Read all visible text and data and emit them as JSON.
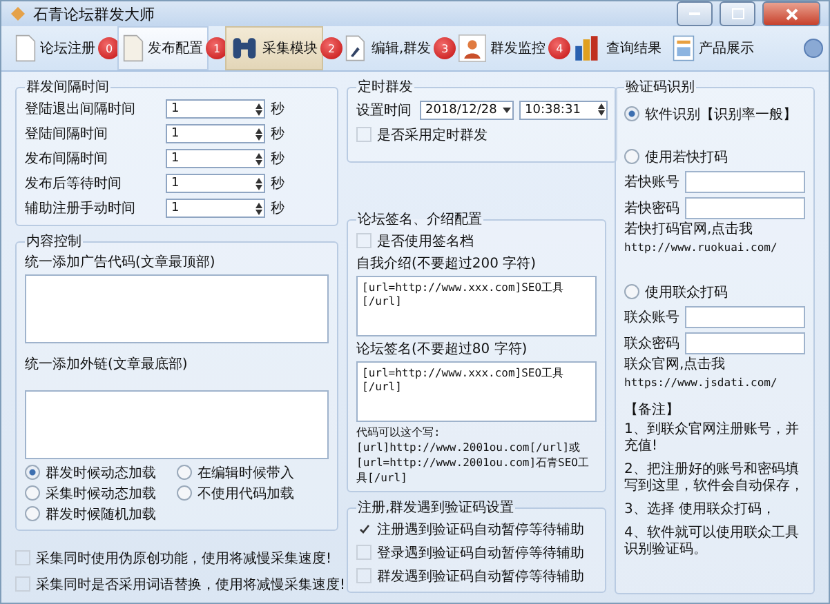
{
  "window": {
    "title": "石青论坛群发大师"
  },
  "toolbar": {
    "tabs": [
      {
        "label": "论坛注册",
        "selected": false,
        "highlighted": false,
        "badge": "0"
      },
      {
        "label": "发布配置",
        "selected": true,
        "highlighted": false,
        "badge": "1"
      },
      {
        "label": "采集模块",
        "selected": false,
        "highlighted": true,
        "badge": "2"
      },
      {
        "label": "编辑,群发",
        "selected": false,
        "highlighted": false,
        "badge": "3"
      },
      {
        "label": "群发监控",
        "selected": false,
        "highlighted": false,
        "badge": "4"
      },
      {
        "label": "查询结果",
        "selected": false,
        "highlighted": false
      },
      {
        "label": "产品展示",
        "selected": false,
        "highlighted": false
      }
    ]
  },
  "intervals": {
    "title": "群发间隔时间",
    "rows": [
      {
        "label": "登陆退出间隔时间",
        "value": "1",
        "unit": "秒"
      },
      {
        "label": "登陆间隔时间",
        "value": "1",
        "unit": "秒"
      },
      {
        "label": "发布间隔时间",
        "value": "1",
        "unit": "秒"
      },
      {
        "label": "发布后等待时间",
        "value": "1",
        "unit": "秒"
      },
      {
        "label": "辅助注册手动时间",
        "value": "1",
        "unit": "秒"
      }
    ]
  },
  "content_control": {
    "title": "内容控制",
    "ad_label": "统一添加广告代码(文章最顶部)",
    "link_label": "统一添加外链(文章最底部)",
    "options": [
      {
        "label": "群发时候动态加载",
        "selected": true
      },
      {
        "label": "在编辑时候带入",
        "selected": false
      },
      {
        "label": "采集时候动态加载",
        "selected": false
      },
      {
        "label": "不使用代码加载",
        "selected": false
      },
      {
        "label": "群发时候随机加载",
        "selected": false
      }
    ]
  },
  "collect_options": [
    {
      "label": "采集同时使用伪原创功能，使用将减慢采集速度!",
      "checked": false
    },
    {
      "label": "采集同时是否采用词语替换，使用将减慢采集速度!",
      "checked": false
    }
  ],
  "schedule": {
    "title": "定时群发",
    "time_label": "设置时间",
    "date": "2018/12/28",
    "time": "10:38:31",
    "enable": {
      "label": "是否采用定时群发",
      "checked": false
    }
  },
  "signature": {
    "title": "论坛签名、介绍配置",
    "use": {
      "label": "是否使用签名档",
      "checked": false
    },
    "intro_label": "自我介绍(不要超过200 字符)",
    "intro": "[url=http://www.xxx.com]SEO工具[/url]",
    "sig_label": "论坛签名(不要超过80 字符)",
    "sig": "[url=http://www.xxx.com]SEO工具[/url]",
    "hint": "代码可以这个写:\n[url]http://www.2001ou.com[/url]或\n[url=http://www.2001ou.com]石青SEO工具[/url]"
  },
  "captcha_settings": {
    "title": "注册,群发遇到验证码设置",
    "options": [
      {
        "label": "注册遇到验证码自动暂停等待辅助",
        "checked": true
      },
      {
        "label": "登录遇到验证码自动暂停等待辅助",
        "checked": false
      },
      {
        "label": "群发遇到验证码自动暂停等待辅助",
        "checked": false
      }
    ]
  },
  "recognition": {
    "title": "验证码识别",
    "software": {
      "label": "软件识别【识别率一般】",
      "selected": true
    },
    "ruokuai": {
      "label": "使用若快打码",
      "selected": false,
      "account_label": "若快账号",
      "password_label": "若快密码",
      "site_text": "若快打码官网,点击我",
      "site_url": "http://www.ruokuai.com/"
    },
    "lianzhong": {
      "label": "使用联众打码",
      "selected": false,
      "account_label": "联众账号",
      "password_label": "联众密码",
      "site_text": "联众官网,点击我",
      "site_url": "https://www.jsdati.com/"
    },
    "notes_title": "【备注】",
    "notes": [
      "1、到联众官网注册账号，并充值!",
      "2、把注册好的账号和密码填写到这里，软件会自动保存，",
      "3、选择 使用联众打码，",
      "4、软件就可以使用联众工具识别验证码。"
    ]
  }
}
